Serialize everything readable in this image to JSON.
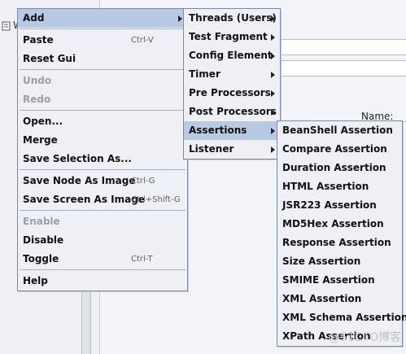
{
  "background": {
    "letter": "W",
    "name_label": "Name:"
  },
  "context_menu": [
    {
      "label": "Add",
      "submenu": true,
      "selected": true
    },
    {
      "separator": true
    },
    {
      "label": "Paste",
      "accelerator": "Ctrl-V"
    },
    {
      "label": "Reset Gui"
    },
    {
      "separator": true
    },
    {
      "label": "Undo",
      "disabled": true
    },
    {
      "label": "Redo",
      "disabled": true
    },
    {
      "separator": true
    },
    {
      "label": "Open..."
    },
    {
      "label": "Merge"
    },
    {
      "label": "Save Selection As..."
    },
    {
      "separator": true
    },
    {
      "label": "Save Node As Image",
      "accelerator": "Ctrl-G"
    },
    {
      "label": "Save Screen As Image",
      "accelerator": "Ctrl+Shift-G"
    },
    {
      "separator": true
    },
    {
      "label": "Enable",
      "disabled": true
    },
    {
      "label": "Disable"
    },
    {
      "label": "Toggle",
      "accelerator": "Ctrl-T"
    },
    {
      "separator": true
    },
    {
      "label": "Help"
    }
  ],
  "add_submenu": [
    {
      "label": "Threads (Users)",
      "submenu": true
    },
    {
      "label": "Test Fragment",
      "submenu": true
    },
    {
      "label": "Config Element",
      "submenu": true
    },
    {
      "label": "Timer",
      "submenu": true
    },
    {
      "label": "Pre Processors",
      "submenu": true
    },
    {
      "label": "Post Processors",
      "submenu": true
    },
    {
      "label": "Assertions",
      "submenu": true,
      "selected": true
    },
    {
      "label": "Listener",
      "submenu": true
    }
  ],
  "assertions_submenu": [
    {
      "label": "BeanShell Assertion"
    },
    {
      "label": "Compare Assertion"
    },
    {
      "label": "Duration Assertion"
    },
    {
      "label": "HTML Assertion"
    },
    {
      "label": "JSR223 Assertion"
    },
    {
      "label": "MD5Hex Assertion"
    },
    {
      "label": "Response Assertion"
    },
    {
      "label": "Size Assertion"
    },
    {
      "label": "SMIME Assertion"
    },
    {
      "label": "XML Assertion"
    },
    {
      "label": "XML Schema Assertion"
    },
    {
      "label": "XPath Assertion"
    }
  ],
  "watermark": "@51CTO博客"
}
